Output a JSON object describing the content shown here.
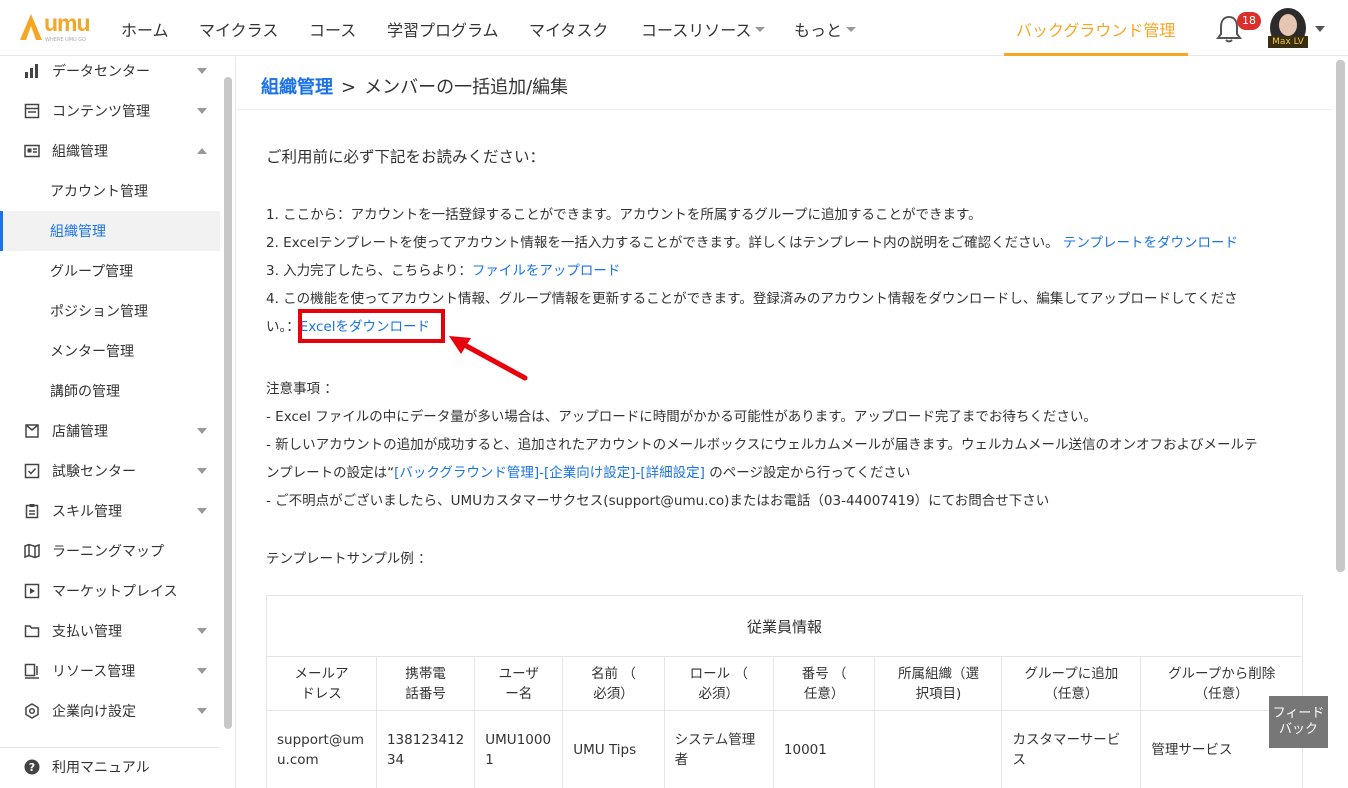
{
  "brand": {
    "logo_text": "umu",
    "logo_sub": "WHERE UMU GO",
    "accent": "#f5a623"
  },
  "nav": {
    "items": [
      "ホーム",
      "マイクラス",
      "コース",
      "学習プログラム",
      "マイタスク",
      "コースリソース",
      "もっと"
    ],
    "active": "バックグラウンド管理",
    "notification_count": "18",
    "user_tag": "Max LV"
  },
  "sidebar": {
    "items": [
      {
        "label": "データセンター",
        "icon": "bar-chart-icon"
      },
      {
        "label": "コンテンツ管理",
        "icon": "content-icon"
      },
      {
        "label": "組織管理",
        "icon": "id-card-icon"
      },
      {
        "label": "アカウント管理"
      },
      {
        "label": "組織管理"
      },
      {
        "label": "グループ管理"
      },
      {
        "label": "ポジション管理"
      },
      {
        "label": "メンター管理"
      },
      {
        "label": "講師の管理"
      },
      {
        "label": "店舗管理",
        "icon": "store-icon"
      },
      {
        "label": "試験センター",
        "icon": "exam-icon"
      },
      {
        "label": "スキル管理",
        "icon": "skill-icon"
      },
      {
        "label": "ラーニングマップ",
        "icon": "map-icon"
      },
      {
        "label": "マーケットプレイス",
        "icon": "market-icon"
      },
      {
        "label": "支払い管理",
        "icon": "folder-icon"
      },
      {
        "label": "リソース管理",
        "icon": "resource-icon"
      },
      {
        "label": "企業向け設定",
        "icon": "settings-icon"
      }
    ],
    "manual": "利用マニュアル"
  },
  "breadcrumb": {
    "parent": "組織管理",
    "separator": ">",
    "current": "メンバーの一括追加/編集"
  },
  "content": {
    "heading": "ご利用前に必ず下記をお読みください：",
    "line1": "1. ここから：アカウントを一括登録することができます。アカウントを所属するグループに追加することができます。",
    "line2": "2. Excelテンプレートを使ってアカウント情報を一括入力することができます。詳しくはテンプレート内の説明をご確認ください。",
    "line2_link": "テンプレートをダウンロード",
    "line3": "3. 入力完了したら、こちらより：",
    "line3_link": "ファイルをアップロード",
    "line4a": "4. この機能を使ってアカウント情報、グループ情報を更新することができます。登録済みのアカウント情報をダウンロードし、編集してアップロードしてくださ",
    "line4b": "い。：",
    "line4_link": "Excelをダウンロード",
    "notes_title": "注意事項 ：",
    "note1": "- Excel ファイルの中にデータ量が多い場合は、アップロードに時間がかかる可能性があります。アップロード完了までお待ちください。",
    "note2a": "- 新しいアカウントの追加が成功すると、追加されたアカウントのメールボックスにウェルカムメールが届きます。ウェルカムメール送信のオンオフおよびメールテ",
    "note2b_pre": "ンプレートの設定は“",
    "note2b_link": "[バックグラウンド管理]-[企業向け設定]-[詳細設定]",
    "note2b_post": " のページ設定から行ってください",
    "note3": "- ご不明点がございましたら、UMUカスタマーサクセス(support@umu.co)またはお電話（03-44007419）にてお問合せ下さい",
    "sample_title": "テンプレートサンプル例 ："
  },
  "table": {
    "caption": "従業員情報",
    "headers": [
      "メールア\nドレス",
      "携帯電\n話番号",
      "ユーザ\nー名",
      "名前 （\n必須）",
      "ロール （\n必須）",
      "番号 （\n任意）",
      "所属組織（選\n択項目)",
      "グループに追加\n（任意）",
      "グループから削除\n（任意）"
    ],
    "row": [
      "support@um\nu.com",
      "138123412\n34",
      "UMU1000\n1",
      "UMU Tips",
      "システム管理\n者",
      "10001",
      "",
      "カスタマーサービ\nス",
      "管理サービス"
    ]
  },
  "feedback": "フィード\nバック"
}
